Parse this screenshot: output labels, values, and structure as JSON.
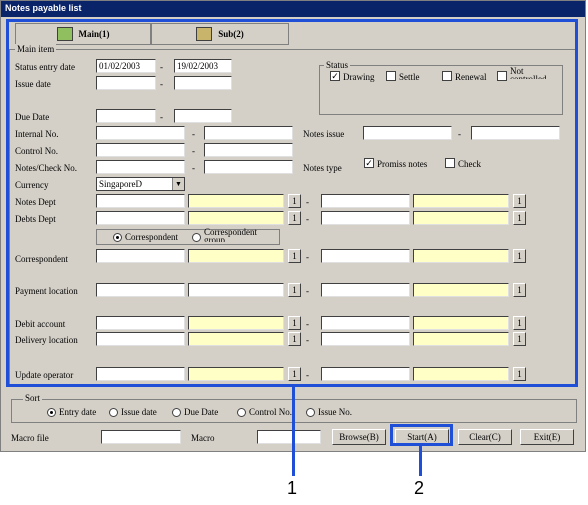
{
  "window": {
    "title": "Notes payable list"
  },
  "tabs": {
    "main": "Main(1)",
    "sub": "Sub(2)"
  },
  "main_item": {
    "group_label": "Main item",
    "status_entry_date": {
      "label": "Status entry date",
      "from": "01/02/2003",
      "to": "19/02/2003"
    },
    "issue_date": {
      "label": "Issue date"
    },
    "due_date": {
      "label": "Due Date"
    },
    "internal_no": {
      "label": "Internal No."
    },
    "control_no": {
      "label": "Control No."
    },
    "notes_check_no": {
      "label": "Notes/Check No."
    },
    "currency": {
      "label": "Currency",
      "value": "SingaporeD"
    },
    "notes_dept": {
      "label": "Notes Dept"
    },
    "debts_dept": {
      "label": "Debts Dept"
    },
    "correspondent": {
      "label": "Correspondent"
    },
    "payment_location": {
      "label": "Payment location"
    },
    "debit_account": {
      "label": "Debit account"
    },
    "delivery_location": {
      "label": "Delivery location"
    },
    "update_operator": {
      "label": "Update operator"
    },
    "notes_issue": {
      "label": "Notes issue"
    },
    "notes_type": {
      "label": "Notes type",
      "promiss": "Promiss notes",
      "check": "Check"
    },
    "corr_radio": {
      "correspondent": "Correspondent",
      "group": "Correspondent group"
    },
    "picker_label": "1",
    "range_sep": "-"
  },
  "status": {
    "label": "Status",
    "drawing": "Drawing",
    "settle": "Settle",
    "renewal": "Renewal",
    "not_controlled": "Not controlled"
  },
  "sort": {
    "label": "Sort",
    "entry_date": "Entry date",
    "issue_date": "Issue date",
    "due_date": "Due Date",
    "control_no": "Control No.",
    "issue_no": "Issue No."
  },
  "bottom": {
    "macro_file": "Macro file",
    "macro": "Macro",
    "browse": "Browse(B)",
    "start": "Start(A)",
    "clear": "Clear(C)",
    "exit": "Exit(E)"
  },
  "callouts": {
    "one": "1",
    "two": "2"
  },
  "colors": {
    "highlight": "#1f4fd6",
    "window": "#d4d0c8",
    "required_field": "#ffffc6"
  }
}
